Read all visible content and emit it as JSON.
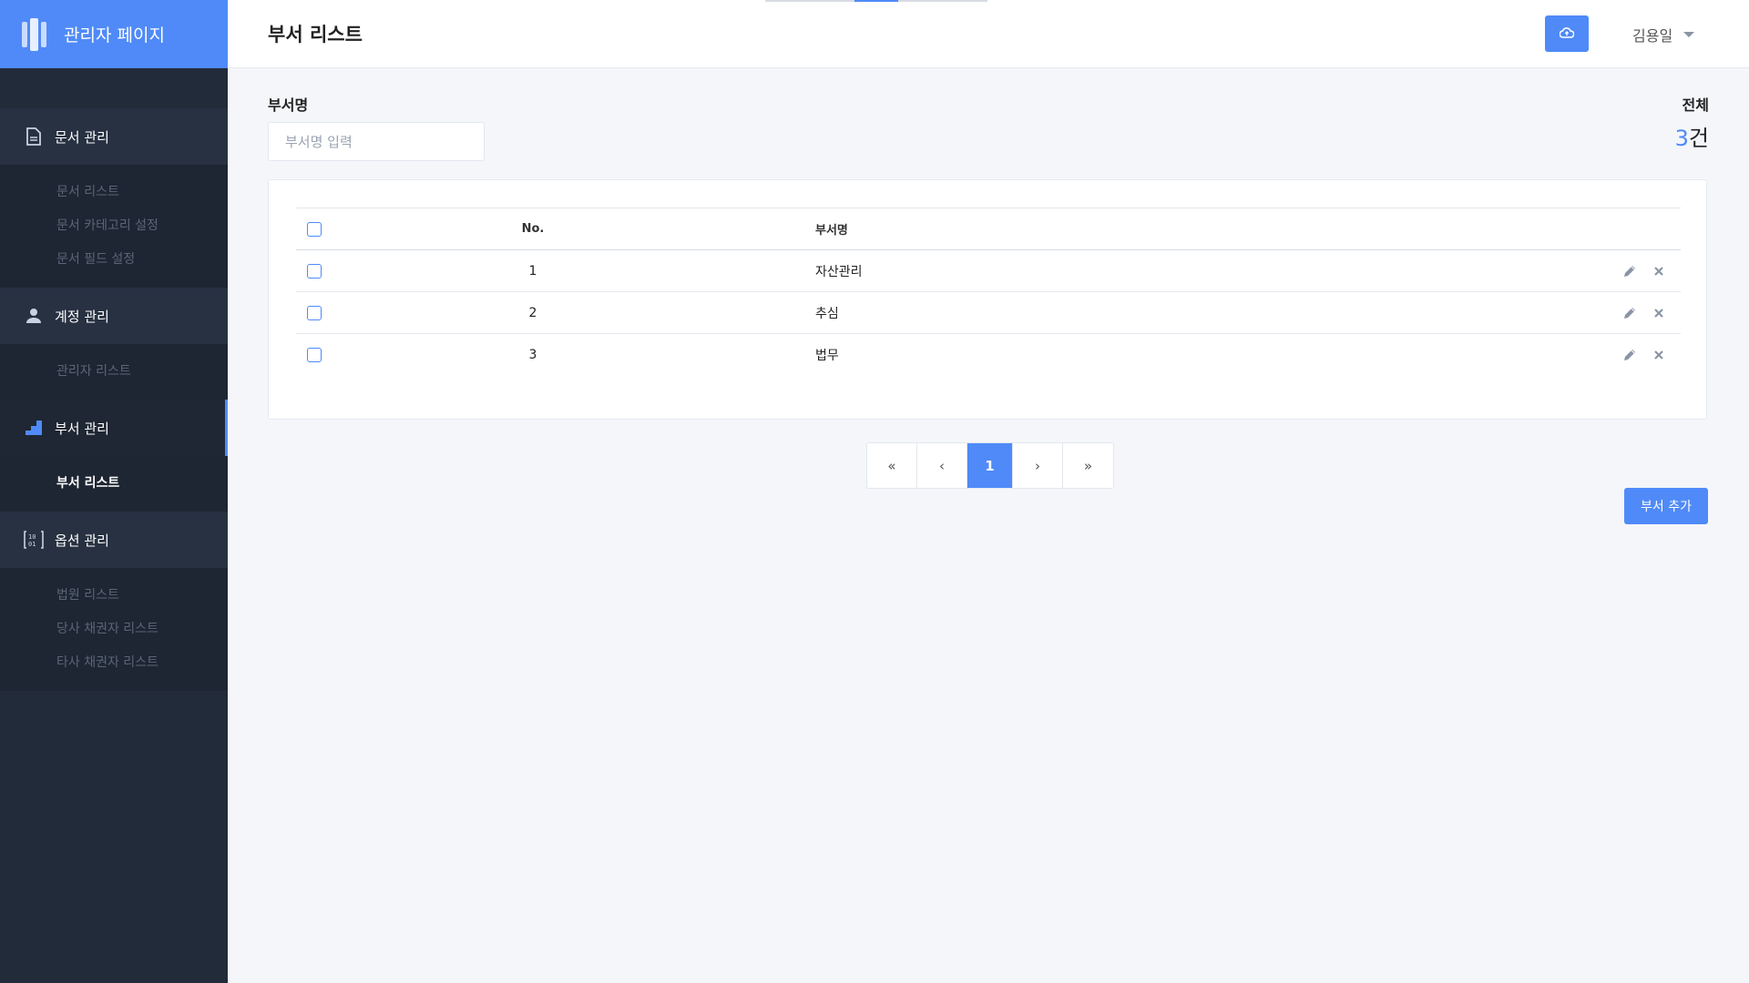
{
  "brand": {
    "title": "관리자 페이지"
  },
  "sidebar": {
    "groups": [
      {
        "label": "문서 관리",
        "icon": "document-icon",
        "items": [
          "문서 리스트",
          "문서 카테고리 설정",
          "문서 필드 설정"
        ]
      },
      {
        "label": "계정 관리",
        "icon": "user-icon",
        "items": [
          "관리자 리스트"
        ]
      },
      {
        "label": "부서 관리",
        "icon": "stairs-icon",
        "items": [
          "부서 리스트"
        ],
        "active": true
      },
      {
        "label": "옵션 관리",
        "icon": "binary-icon",
        "items": [
          "법원 리스트",
          "당사 채권자 리스트",
          "타사 채권자 리스트"
        ]
      }
    ],
    "active_item": "부서 리스트"
  },
  "header": {
    "title": "부서 리스트",
    "cloud_button_icon": "cloud-upload-icon",
    "user_name": "김용일"
  },
  "filter": {
    "label": "부서명",
    "placeholder": "부서명 입력",
    "value": ""
  },
  "total": {
    "label": "전체",
    "count": "3",
    "unit": "건"
  },
  "table": {
    "columns": {
      "no": "No.",
      "name": "부서명"
    },
    "rows": [
      {
        "no": "1",
        "name": "자산관리"
      },
      {
        "no": "2",
        "name": "추심"
      },
      {
        "no": "3",
        "name": "법무"
      }
    ]
  },
  "pagination": {
    "first": "«",
    "prev": "‹",
    "current": "1",
    "next": "›",
    "last": "»"
  },
  "actions": {
    "add_label": "부서 추가"
  },
  "colors": {
    "accent": "#4f8af8",
    "sidebar": "#222b3a"
  }
}
